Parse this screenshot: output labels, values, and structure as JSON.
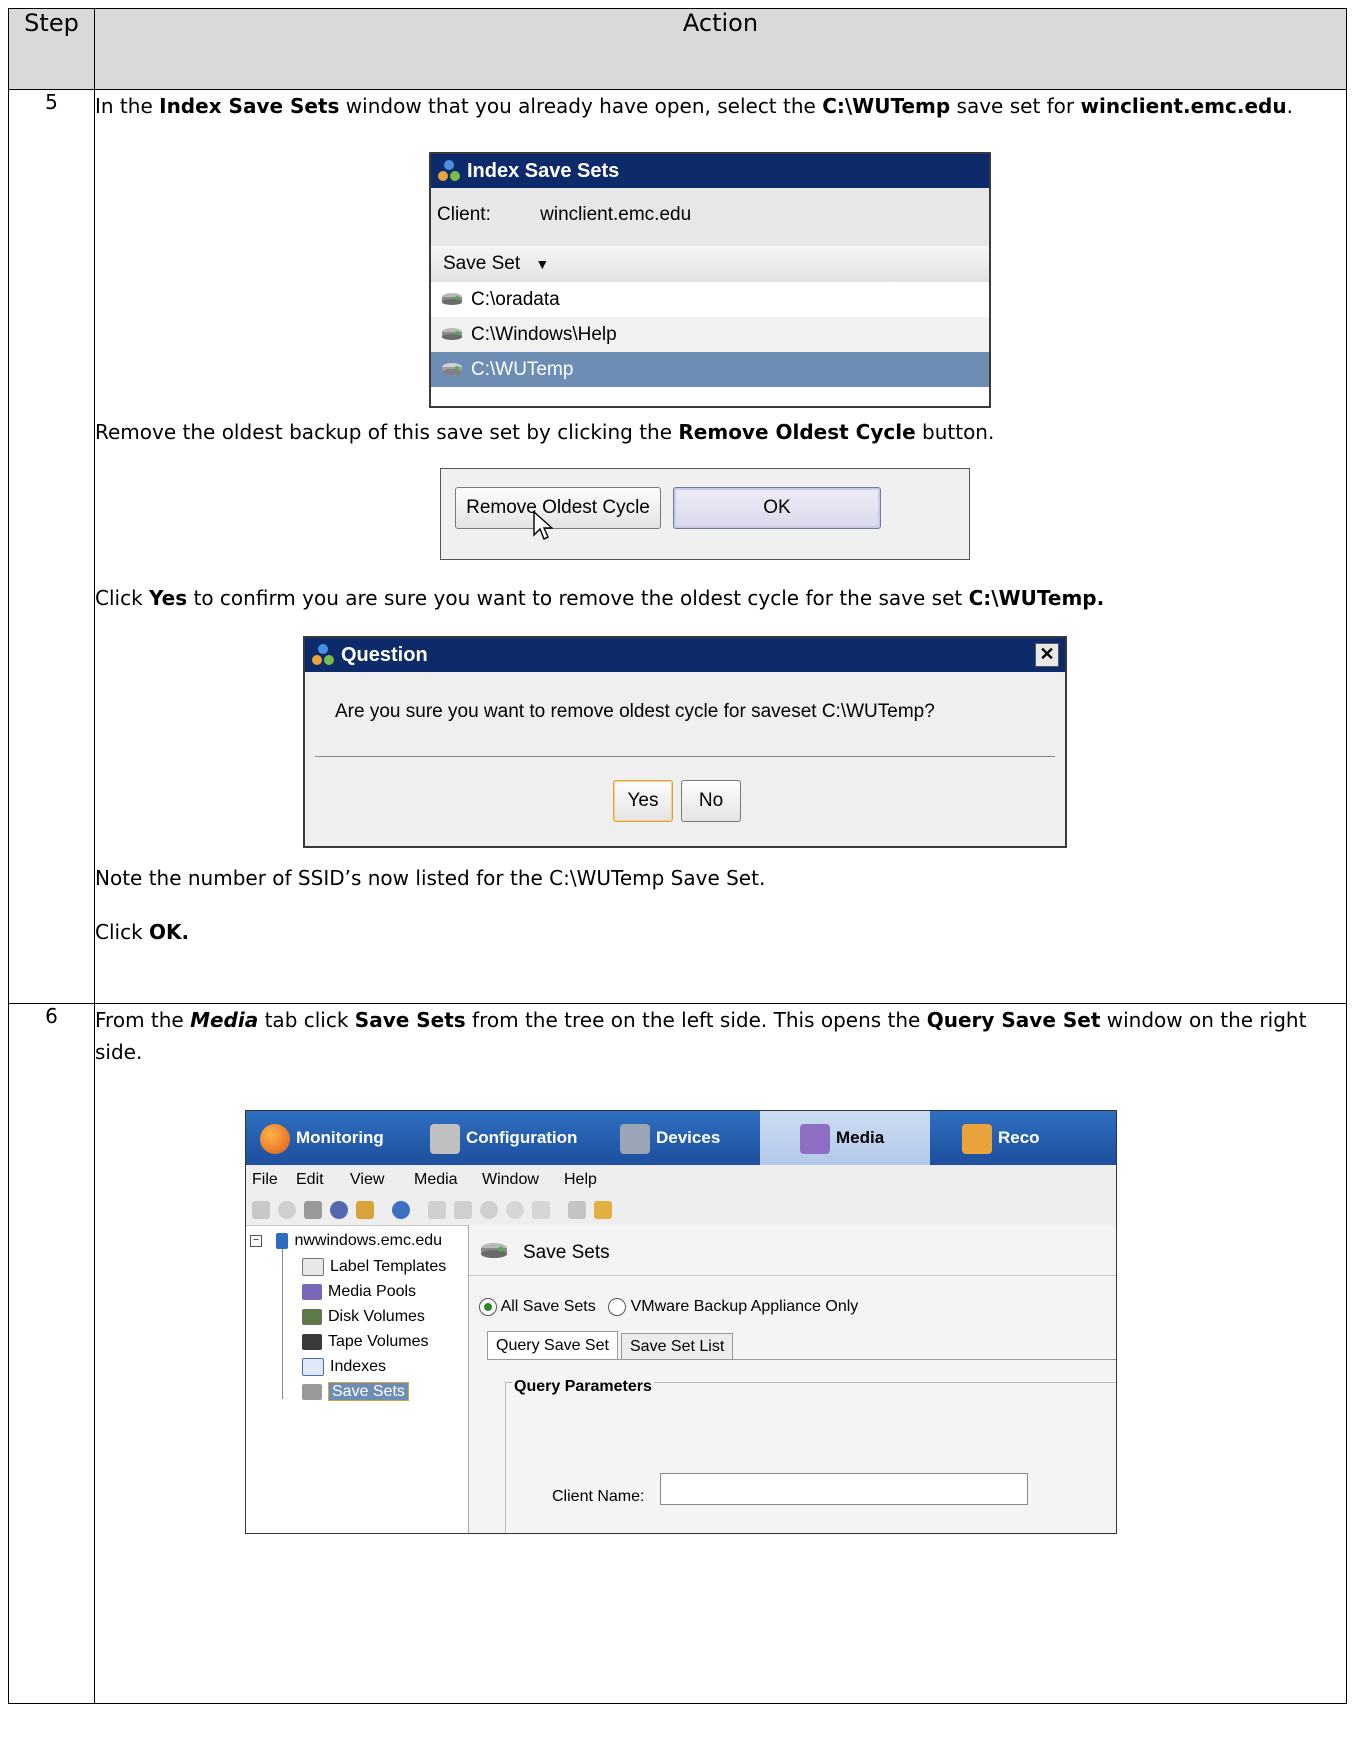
{
  "header": {
    "step": "Step",
    "action": "Action"
  },
  "step5": {
    "number": "5",
    "p1": {
      "a": "In the ",
      "b1": "Index Save Sets",
      "c": " window that you already have open, select the ",
      "b2": "C:\\WUTemp",
      "d": " save set for ",
      "b3": "winclient.emc.edu",
      "e": "."
    },
    "index_window": {
      "title": "Index Save Sets",
      "client_label": "Client:",
      "client_value": "winclient.emc.edu",
      "column_header": "Save Set",
      "rows": [
        "C:\\oradata",
        "C:\\Windows\\Help",
        "C:\\WUTemp"
      ],
      "selected_row": "C:\\WUTemp"
    },
    "p2": {
      "a": "Remove the oldest backup of this save set by clicking the ",
      "b1": "Remove Oldest Cycle",
      "c": " button."
    },
    "buttons": {
      "remove": "Remove Oldest Cycle",
      "ok": "OK"
    },
    "p3": {
      "a": "Click ",
      "b1": "Yes",
      "c": " to confirm you are sure you want to remove the oldest cycle for the save set ",
      "b2": "C:\\WUTemp."
    },
    "question": {
      "title": "Question",
      "close": "✕",
      "message": "Are you sure you want to remove oldest cycle for saveset C:\\WUTemp?",
      "yes": "Yes",
      "no": "No"
    },
    "p4": "Note the number of SSID’s now listed for the C:\\WUTemp Save Set.",
    "p5": {
      "a": "Click ",
      "b1": "OK."
    }
  },
  "step6": {
    "number": "6",
    "p1": {
      "a": "From the ",
      "bi": "Media",
      "c": " tab click ",
      "b1": "Save Sets",
      "d": " from the tree on the left side.  This opens the ",
      "b2": "Query Save Set",
      "e": " window on the right side."
    },
    "app": {
      "tabs": [
        "Monitoring",
        "Configuration",
        "Devices",
        "Media",
        "Reco"
      ],
      "active_tab": "Media",
      "menu": [
        "File",
        "Edit",
        "View",
        "Media",
        "Window",
        "Help"
      ],
      "tree_root": "nwwindows.emc.edu",
      "tree_items": [
        "Label Templates",
        "Media Pools",
        "Disk Volumes",
        "Tape Volumes",
        "Indexes",
        "Save Sets"
      ],
      "selected_tree_item": "Save Sets",
      "panel_title": "Save Sets",
      "radio_all": "All Save Sets",
      "radio_vmware": "VMware Backup Appliance Only",
      "subtab_query": "Query Save Set",
      "subtab_list": "Save Set List",
      "group_title": "Query Parameters",
      "client_name_label": "Client Name:"
    }
  },
  "colors": {
    "title_bar": "#0d2a6b",
    "selection": "#6d8db5",
    "tab_bar": "#1d4f9e",
    "header_bg": "#d9d9d9"
  }
}
